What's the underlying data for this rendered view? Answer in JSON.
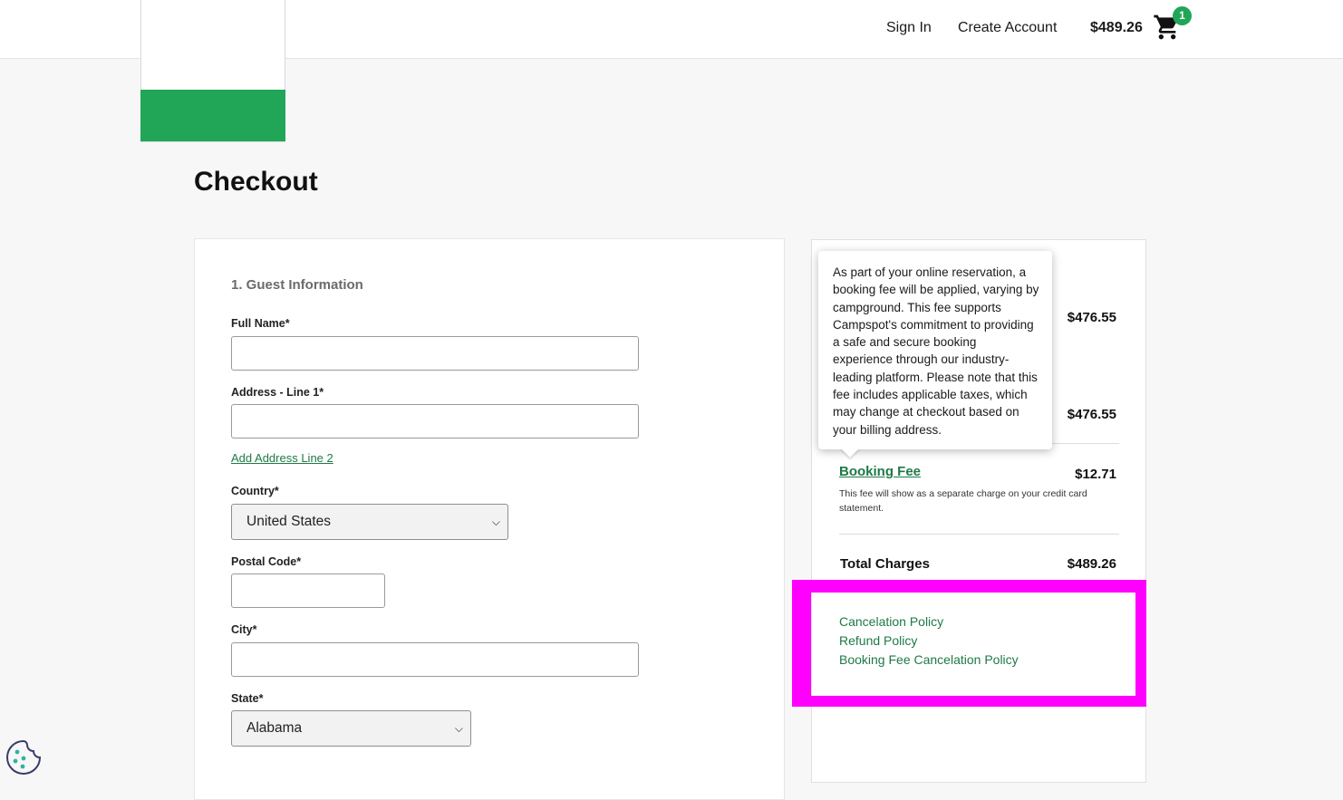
{
  "header": {
    "sign_in": "Sign In",
    "create_account": "Create Account",
    "cart_total": "$489.26",
    "cart_count": "1"
  },
  "page": {
    "title": "Checkout"
  },
  "guest_info": {
    "section_title": "1. Guest Information",
    "full_name_label": "Full Name*",
    "full_name_value": "",
    "address1_label": "Address - Line 1*",
    "address1_value": "",
    "add_address_line2": "Add Address Line 2",
    "country_label": "Country*",
    "country_value": "United States",
    "postal_label": "Postal Code*",
    "postal_value": "",
    "city_label": "City*",
    "city_value": "",
    "state_label": "State*",
    "state_value": "Alabama"
  },
  "summary": {
    "subtotal_1": "$476.55",
    "subtotal_2": "$476.55",
    "booking_fee_label": "Booking Fee",
    "booking_fee_value": "$12.71",
    "booking_fee_note": "This fee will show as a separate charge on your credit card statement.",
    "total_label": "Total Charges",
    "total_value": "$489.26",
    "policies": [
      "Cancelation Policy",
      "Refund Policy",
      "Booking Fee Cancelation Policy"
    ]
  },
  "tooltip": {
    "text": "As part of your online reservation, a booking fee will be applied, varying by campground. This fee supports Campspot's commitment to providing a safe and secure booking experience through our industry-leading platform. Please note that this fee includes applicable taxes, which may change at checkout based on your billing address."
  },
  "colors": {
    "brand_green": "#21a658",
    "link_green": "#1e7a46",
    "highlight": "#ff00ff"
  },
  "icons": {
    "cart": "cart-icon",
    "cookie": "cookie-icon",
    "chevron": "chevron-down-icon"
  }
}
